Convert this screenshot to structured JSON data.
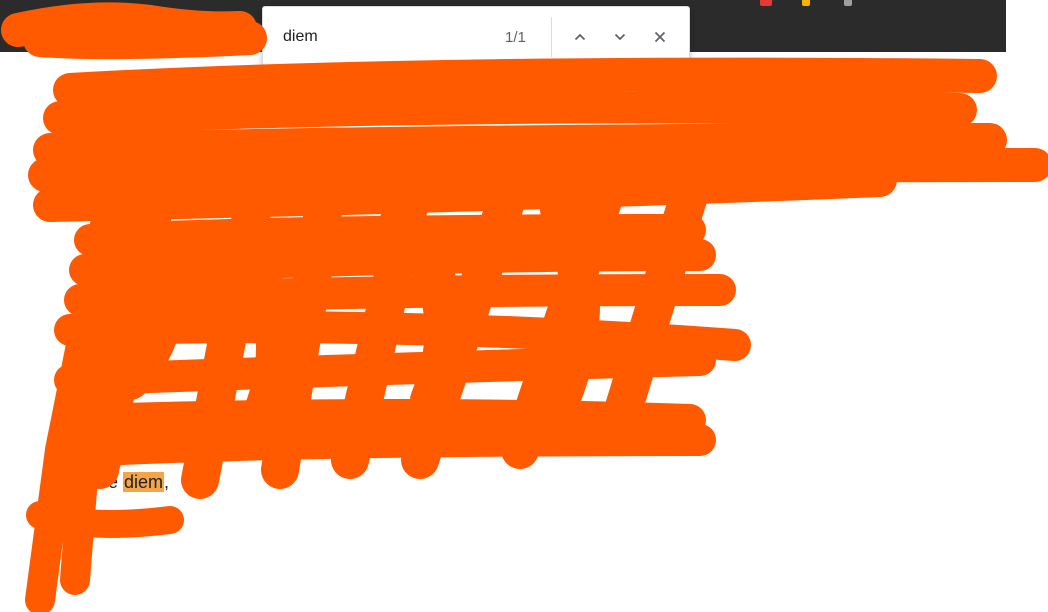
{
  "find": {
    "query": "diem",
    "match_count": "1/1",
    "prev_icon": "chevron-up-icon",
    "next_icon": "chevron-down-icon",
    "close_icon": "close-icon"
  },
  "document": {
    "visible_text_prefix": "e",
    "highlighted_match": "diem",
    "visible_text_suffix": ","
  },
  "colors": {
    "redaction": "#ff5a00",
    "match_highlight": "#f3a54a",
    "topbar": "#2b2b2b"
  }
}
